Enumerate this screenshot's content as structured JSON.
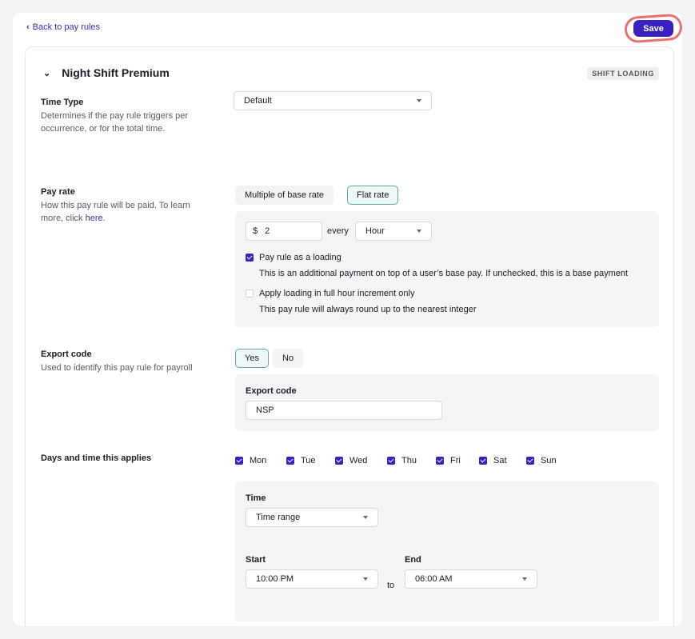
{
  "header": {
    "back_label": "Back to pay rules",
    "save_label": "Save"
  },
  "rule": {
    "title": "Night Shift Premium",
    "badge": "SHIFT LOADING"
  },
  "time_type": {
    "label": "Time Type",
    "description": "Determines if the pay rule triggers per occurrence, or for the total time.",
    "selected": "Default"
  },
  "pay_rate": {
    "label": "Pay rate",
    "description_prefix": "How this pay rule will be paid. To learn more, click ",
    "link_text": "here",
    "description_suffix": ".",
    "options": [
      "Multiple of base rate",
      "Flat rate"
    ],
    "active_option": "Flat rate",
    "currency_symbol": "$",
    "amount": "2",
    "every_label": "every",
    "period": "Hour",
    "loading_checkbox_label": "Pay rule as a loading",
    "loading_checked": true,
    "loading_help": "This is an additional payment on top of a user’s base pay. If unchecked, this is a base payment",
    "increment_checkbox_label": "Apply loading in full hour increment only",
    "increment_checked": false,
    "increment_help": "This pay rule will always round up to the nearest integer"
  },
  "export_code": {
    "label": "Export code",
    "description": "Used to identify this pay rule for payroll",
    "options": [
      "Yes",
      "No"
    ],
    "active_option": "Yes",
    "field_label": "Export code",
    "value": "NSP"
  },
  "days": {
    "label": "Days and time this applies",
    "items": [
      {
        "label": "Mon",
        "checked": true
      },
      {
        "label": "Tue",
        "checked": true
      },
      {
        "label": "Wed",
        "checked": true
      },
      {
        "label": "Thu",
        "checked": true
      },
      {
        "label": "Fri",
        "checked": true
      },
      {
        "label": "Sat",
        "checked": true
      },
      {
        "label": "Sun",
        "checked": true
      }
    ],
    "time_label": "Time",
    "time_mode": "Time range",
    "start_label": "Start",
    "start_value": "10:00 PM",
    "to_label": "to",
    "end_label": "End",
    "end_value": "06:00 AM"
  },
  "colors": {
    "accent": "#3a1fc1",
    "active_border": "#5aaba2",
    "highlight": "#e8726f"
  }
}
